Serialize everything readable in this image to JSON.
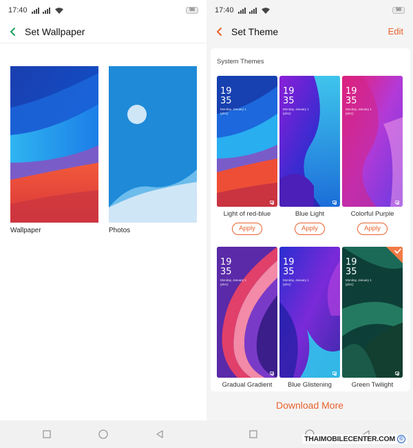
{
  "status_bar": {
    "time": "17:40",
    "battery": "98"
  },
  "left_screen": {
    "title": "Set Wallpaper",
    "options": [
      {
        "label": "Wallpaper"
      },
      {
        "label": "Photos"
      }
    ]
  },
  "right_screen": {
    "title": "Set Theme",
    "edit_label": "Edit",
    "section_label": "System Themes",
    "lock_time_hour": "19",
    "lock_time_minute": "35",
    "lock_date": "Monday, January 1",
    "lock_date_sub": "(ρίσς)",
    "themes": [
      {
        "name": "Light of red-blue",
        "apply_label": "Apply"
      },
      {
        "name": "Blue Light",
        "apply_label": "Apply"
      },
      {
        "name": "Colorful Purple",
        "apply_label": "Apply"
      },
      {
        "name": "Gradual Gradient"
      },
      {
        "name": "Blue Glistening"
      },
      {
        "name": "Green Twilight",
        "selected": true
      }
    ],
    "download_more": "Download More"
  },
  "watermark": "THAIMOBILECENTER.COM",
  "colors": {
    "accent": "#e8612c",
    "left_back_arrow": "#1aa260"
  },
  "icons": [
    "back-arrow-icon",
    "signal-icon",
    "wifi-icon",
    "battery-icon",
    "camera-icon",
    "check-icon",
    "square-nav-icon",
    "circle-nav-icon",
    "triangle-back-nav-icon",
    "copyright-icon"
  ]
}
